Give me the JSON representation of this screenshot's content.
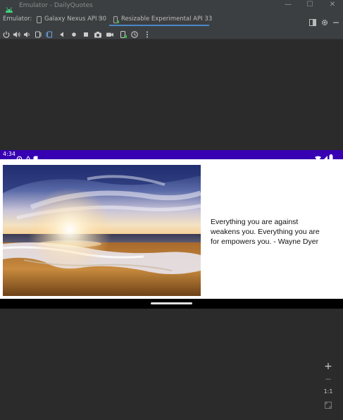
{
  "window": {
    "title": "Emulator - DailyQuotes",
    "controls": {
      "minimize": "—",
      "maximize": "☐",
      "close": "✕"
    }
  },
  "tabs": {
    "emulator_label": "Emulator:",
    "items": [
      {
        "label": "Galaxy Nexus API 30",
        "active": false
      },
      {
        "label": "Resizable Experimental API 33",
        "active": true
      }
    ],
    "close_glyph": "×"
  },
  "toolbar": {
    "icons": [
      "power-icon",
      "volume-up-icon",
      "volume-down-icon",
      "rotate-left-icon",
      "rotate-right-icon",
      "back-icon",
      "home-icon",
      "overview-icon",
      "screenshot-icon",
      "screen-record-icon",
      "fold-icon",
      "snapshot-icon",
      "more-icon"
    ]
  },
  "device": {
    "status_time": "4:34",
    "quote": "Everything you are against\nweakens you. Everything you are\nfor empowers you.  -  Wayne Dyer"
  },
  "zoom": {
    "in": "+",
    "out": "−",
    "actual": "1:1"
  },
  "colors": {
    "accent": "#4a88c7",
    "status_bar": "#3700b3",
    "ide_bg": "#2b2b2b",
    "panel": "#3c3f41"
  }
}
